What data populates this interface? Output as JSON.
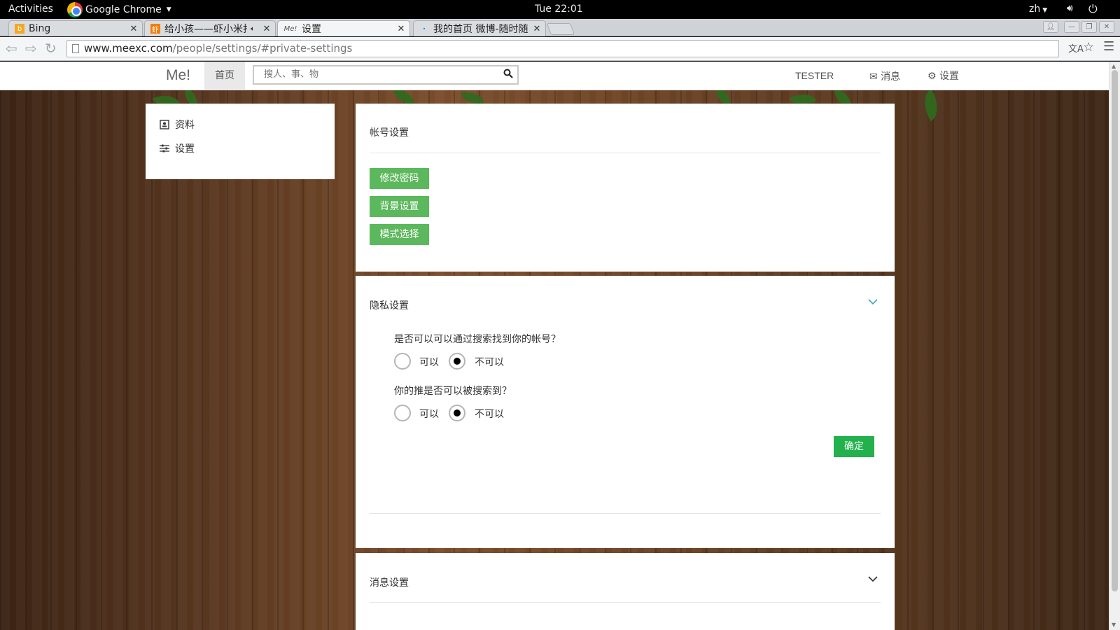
{
  "os_bar": {
    "activities": "Activities",
    "app_menu": "Google Chrome",
    "clock": "Tue 22:01",
    "lang": "zh"
  },
  "browser": {
    "tabs": [
      {
        "title": "Bing",
        "favicon": "bing-icon"
      },
      {
        "title": "给小孩——虾小米打",
        "favicon": "xiami-icon",
        "audio": true
      },
      {
        "title": "设置",
        "favicon": "meexc-icon",
        "active": true
      },
      {
        "title": "我的首页 微博-随时随",
        "favicon": "weibo-icon"
      }
    ],
    "url_host": "www.meexc.com",
    "url_path": "/people/settings/#private-settings"
  },
  "site": {
    "brand": "Me!",
    "home": "首页",
    "search_placeholder": "搜人、事、物",
    "user": "TESTER",
    "messages": "消息",
    "settings": "设置"
  },
  "sidebar": {
    "items": [
      {
        "label": "资料",
        "icon": "profile-icon"
      },
      {
        "label": "设置",
        "icon": "sliders-icon"
      }
    ]
  },
  "account_panel": {
    "title": "帐号设置",
    "buttons": [
      "修改密码",
      "背景设置",
      "模式选择"
    ]
  },
  "privacy_panel": {
    "title": "隐私设置",
    "questions": [
      {
        "text": "是否可以可以通过搜索找到你的帐号？",
        "options": [
          "可以",
          "不可以"
        ],
        "selected": "不可以"
      },
      {
        "text": "你的推是否可以被搜索到？",
        "options": [
          "可以",
          "不可以"
        ],
        "selected": "不可以"
      }
    ],
    "confirm": "确定"
  },
  "message_panel": {
    "title": "消息设置"
  },
  "colors": {
    "button_green": "#5cb85c",
    "confirm_green": "#22b14c"
  }
}
